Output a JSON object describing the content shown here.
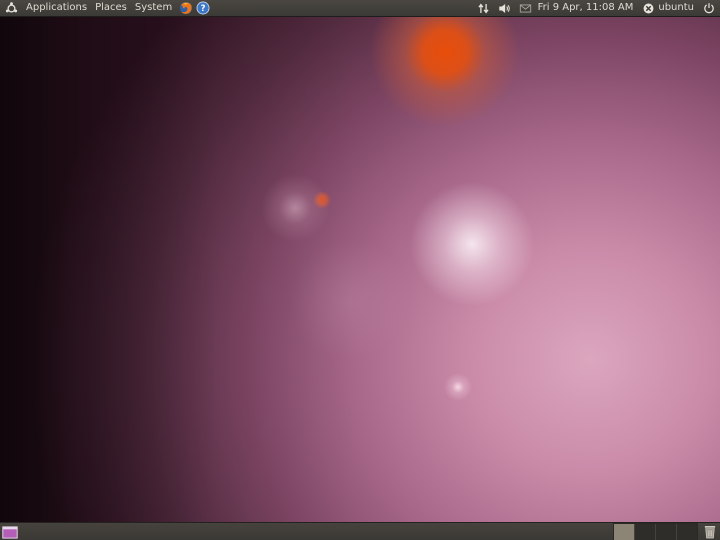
{
  "top_panel": {
    "menus": {
      "applications": "Applications",
      "places": "Places",
      "system": "System"
    },
    "launchers": [
      "firefox-icon",
      "help-icon"
    ],
    "indicators": [
      "network-icon",
      "volume-icon",
      "mail-icon"
    ],
    "clock": "Fri  9 Apr, 11:08 AM",
    "user": "ubuntu"
  },
  "bottom_panel": {
    "workspaces": [
      {
        "active": true
      },
      {
        "active": false
      },
      {
        "active": false
      },
      {
        "active": false
      }
    ]
  },
  "colors": {
    "panel": "#3c3a36",
    "panel_text": "#dfdbd2",
    "wallpaper_accent": "#e84e0a",
    "wallpaper_pink": "#dca6bf"
  }
}
